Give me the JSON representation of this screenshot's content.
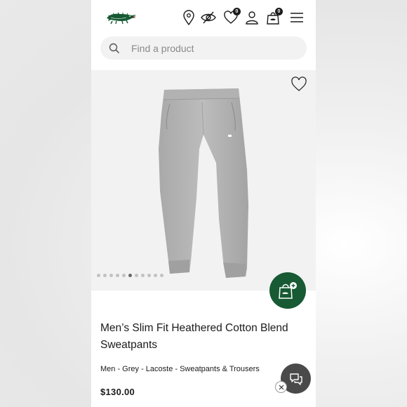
{
  "header": {
    "logo": "crocodile-logo",
    "icons": [
      "store-locator-icon",
      "accessibility-eye-icon",
      "wishlist-heart-icon",
      "account-icon",
      "cart-bag-icon",
      "menu-icon"
    ],
    "wishlist_count": "0",
    "cart_count": "0"
  },
  "search": {
    "placeholder": "Find a product",
    "icon": "search-icon"
  },
  "product": {
    "image_icon": "grey-sweatpants-image",
    "carousel": {
      "total": 11,
      "active": 5
    },
    "title": "Men’s Slim Fit Heathered Cotton Blend Sweatpants",
    "breadcrumb": "Men - Grey - Lacoste - Sweatpants & Trousers",
    "price": "$130.00"
  },
  "colors": {
    "brand_green": "#175a34",
    "image_bg": "#f2f2f2",
    "chat_bg": "#4a4a4a"
  }
}
